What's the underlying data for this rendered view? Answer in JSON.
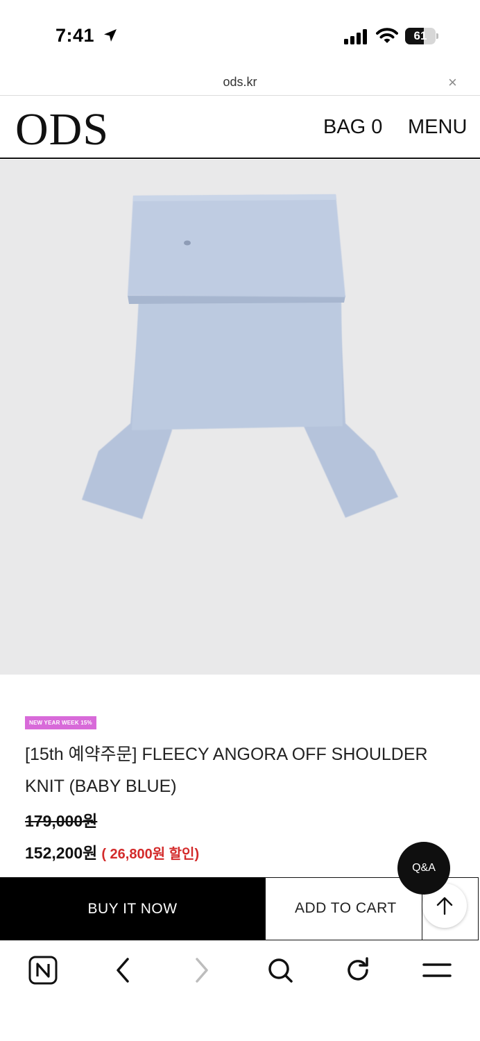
{
  "status_bar": {
    "time": "7:41",
    "battery": "61",
    "battery_level": 0.61
  },
  "url_bar": {
    "url": "ods.kr",
    "close_glyph": "×"
  },
  "header": {
    "logo": "ODS",
    "bag": "BAG 0",
    "menu": "MENU"
  },
  "product": {
    "promo_badge": "NEW YEAR WEEK 15%",
    "title": "[15th 예약주문] FLEECY ANGORA OFF SHOULDER KNIT (BABY BLUE)",
    "original_price": "179,000원",
    "sale_price": "152,200원",
    "discount": "( 26,800원 할인)"
  },
  "actions": {
    "buy_now": "BUY IT NOW",
    "add_to_cart": "ADD TO CART",
    "qa": "Q&A"
  },
  "colors": {
    "accent_badge": "#d86ad9",
    "discount_red": "#d32a2a",
    "product_blue": "#b8c6de"
  }
}
